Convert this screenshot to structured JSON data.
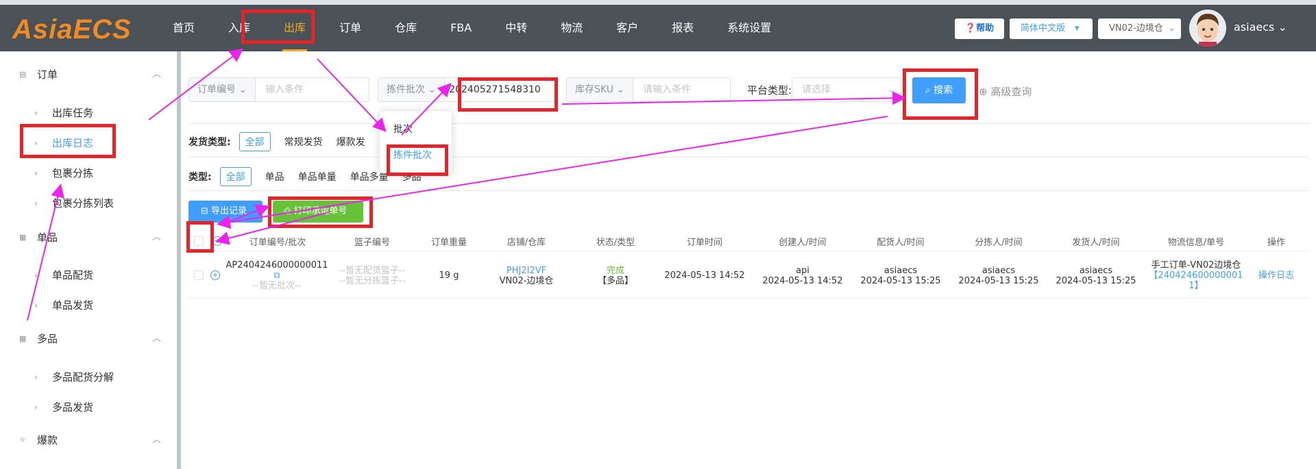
{
  "logo": "AsiaECS",
  "nav": [
    "首页",
    "入库",
    "出库",
    "订单",
    "仓库",
    "FBA",
    "中转",
    "物流",
    "客户",
    "报表",
    "系统设置"
  ],
  "active_nav_index": 2,
  "header": {
    "help": "帮助",
    "language": "简体中文版",
    "warehouse": "VN02-边境仓",
    "user": "asiaecs"
  },
  "sidebar": {
    "groups": [
      {
        "label": "订单",
        "items": [
          "出库任务",
          "出库日志",
          "包裹分拣",
          "包裹分拣列表"
        ]
      },
      {
        "label": "单品",
        "items": [
          "单品配货",
          "单品发货"
        ]
      },
      {
        "label": "多品",
        "items": [
          "多品配货分解",
          "多品发货"
        ]
      },
      {
        "label": "爆款",
        "items": []
      }
    ],
    "active_item": "出库日志"
  },
  "filters": {
    "order_no_label": "订单编号",
    "order_no_placeholder": "输入条件",
    "batch_label": "拣件批次",
    "batch_value": "202405271548310",
    "sku_label": "库存SKU",
    "sku_placeholder": "请输入条件",
    "platform_label": "平台类型:",
    "platform_placeholder": "请选择",
    "search": "搜索",
    "advanced": "高级查询"
  },
  "batch_dropdown": [
    "批次",
    "拣件批次"
  ],
  "ship_type": {
    "title": "发货类型:",
    "options": [
      "全部",
      "常规发货",
      "爆款发"
    ]
  },
  "type_filter": {
    "title": "类型:",
    "options": [
      "全部",
      "单品",
      "单品单量",
      "单品多量",
      "多品"
    ]
  },
  "actions": {
    "export": "导出记录",
    "print": "打印承运单号"
  },
  "table": {
    "headers": [
      "订单编号/批次",
      "篮子编号",
      "订单重量",
      "店铺/仓库",
      "状态/类型",
      "订单时间",
      "创建人/时间",
      "配货人/时间",
      "分拣人/时间",
      "发货人/时间",
      "物流信息/单号",
      "操作"
    ],
    "rows": [
      {
        "order_no": "AP2404246000000011",
        "batch": "--暂无批次--",
        "basket_1": "--暂无配货篮子--",
        "basket_2": "--暂无分拣篮子--",
        "weight": "19 g",
        "shop": "PHJ2I2VF",
        "warehouse": "VN02-边境仓",
        "status": "完成",
        "type": "【多品】",
        "order_time": "2024-05-13 14:52",
        "creator": "api",
        "create_time": "2024-05-13 14:52",
        "picker": "asiaecs",
        "pick_time": "2024-05-13 15:25",
        "sorter": "asiaecs",
        "sort_time": "2024-05-13 15:25",
        "shipper": "asiaecs",
        "ship_time": "2024-05-13 15:25",
        "logistics_1": "手工订单-VN02边境仓",
        "logistics_2": "【240424600000001",
        "logistics_3": "1】",
        "op": "操作日志"
      }
    ]
  },
  "colors": {
    "topbar": "#4a5157",
    "accent": "#f5a623",
    "primary": "#409eff",
    "success": "#67c23a",
    "annotation": "#e5242a",
    "arrow": "#ee22ee"
  }
}
